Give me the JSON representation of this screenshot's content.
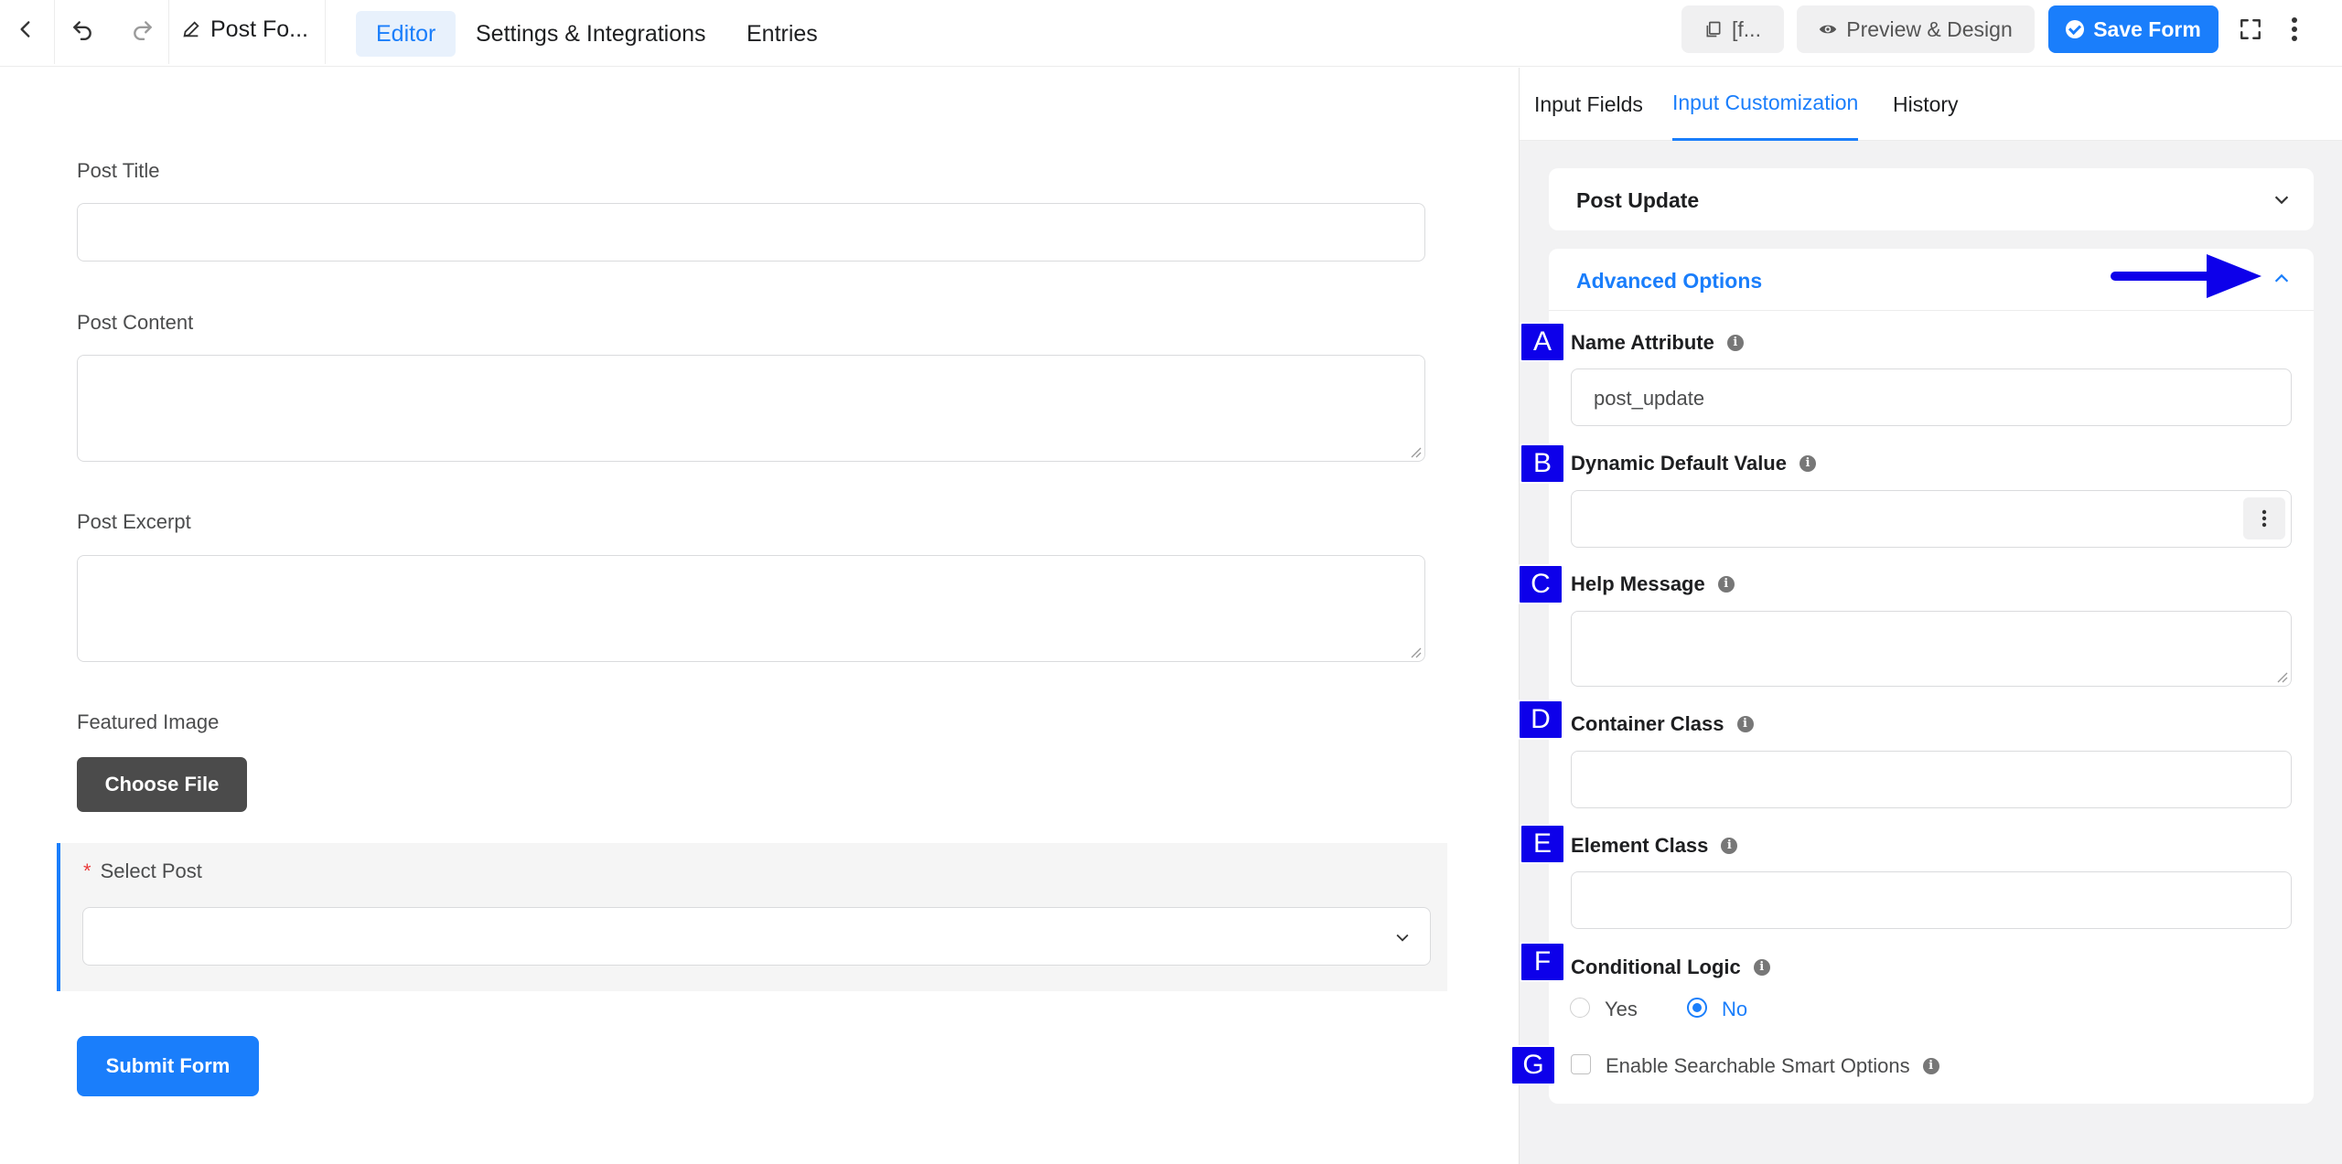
{
  "toolbar": {
    "form_name": "Post Fo...",
    "tabs": [
      "Editor",
      "Settings & Integrations",
      "Entries"
    ],
    "shortcode_label": "[f...",
    "preview_label": "Preview & Design",
    "save_label": "Save Form"
  },
  "form": {
    "fields": {
      "post_title": "Post Title",
      "post_content": "Post Content",
      "post_excerpt": "Post Excerpt",
      "featured_image": "Featured Image"
    },
    "choose_file_label": "Choose File",
    "select_post": {
      "required_mark": "*",
      "label": "Select Post"
    },
    "submit_label": "Submit Form"
  },
  "panel": {
    "tabs": [
      "Input Fields",
      "Input Customization",
      "History"
    ],
    "active_tab": "Input Customization",
    "section_post_update": "Post Update",
    "section_advanced": "Advanced Options",
    "fields": {
      "name_attribute": {
        "label": "Name Attribute",
        "value": "post_update"
      },
      "dynamic_default": {
        "label": "Dynamic Default Value",
        "value": ""
      },
      "help_message": {
        "label": "Help Message",
        "value": ""
      },
      "container_class": {
        "label": "Container Class",
        "value": ""
      },
      "element_class": {
        "label": "Element Class",
        "value": ""
      },
      "conditional_logic": {
        "label": "Conditional Logic",
        "options": [
          "Yes",
          "No"
        ],
        "selected": "No"
      },
      "searchable": {
        "label": "Enable Searchable Smart Options",
        "checked": false
      }
    },
    "info_glyph": "i"
  },
  "annotations": {
    "badges": [
      "A",
      "B",
      "C",
      "D",
      "E",
      "F",
      "G"
    ],
    "arrow_color": "#0d00ea"
  },
  "colors": {
    "accent": "#1a7efb",
    "badge": "#0d00ea",
    "required": "#e93a3a"
  }
}
